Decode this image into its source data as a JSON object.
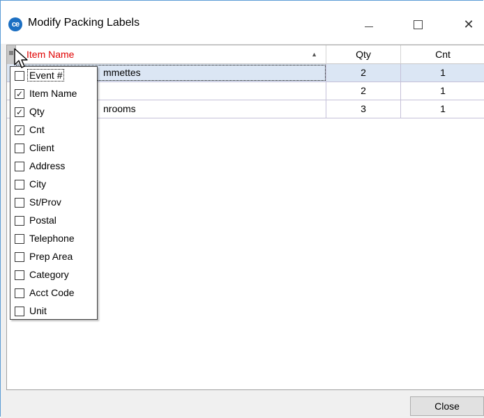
{
  "window": {
    "title": "Modify Packing Labels",
    "app_icon_text": "ce",
    "minimize_glyph": "",
    "maximize_glyph": "",
    "close_glyph": "✕"
  },
  "grid": {
    "columns": [
      {
        "label": "Item Name",
        "sort": "ascending",
        "color": "#e00000"
      },
      {
        "label": "Qty"
      },
      {
        "label": "Cnt"
      }
    ],
    "sort_glyph": "▲",
    "rows": [
      {
        "item": "mmettes",
        "qty": "2",
        "cnt": "1",
        "selected": true
      },
      {
        "item": "",
        "qty": "2",
        "cnt": "1",
        "selected": false
      },
      {
        "item": "nrooms",
        "qty": "3",
        "cnt": "1",
        "selected": false
      }
    ]
  },
  "column_chooser": {
    "check_glyph": "✓",
    "options": [
      {
        "label": "Event #",
        "checked": false
      },
      {
        "label": "Item Name",
        "checked": true
      },
      {
        "label": "Qty",
        "checked": true
      },
      {
        "label": "Cnt",
        "checked": true
      },
      {
        "label": "Client",
        "checked": false
      },
      {
        "label": "Address",
        "checked": false
      },
      {
        "label": "City",
        "checked": false
      },
      {
        "label": "St/Prov",
        "checked": false
      },
      {
        "label": "Postal",
        "checked": false
      },
      {
        "label": "Telephone",
        "checked": false
      },
      {
        "label": "Prep Area",
        "checked": false
      },
      {
        "label": "Category",
        "checked": false
      },
      {
        "label": "Acct Code",
        "checked": false
      },
      {
        "label": "Unit",
        "checked": false
      }
    ]
  },
  "footer": {
    "close_label": "Close"
  },
  "icons": {
    "app": "ce-logo-icon",
    "cursor": "mouse-pointer-icon"
  }
}
